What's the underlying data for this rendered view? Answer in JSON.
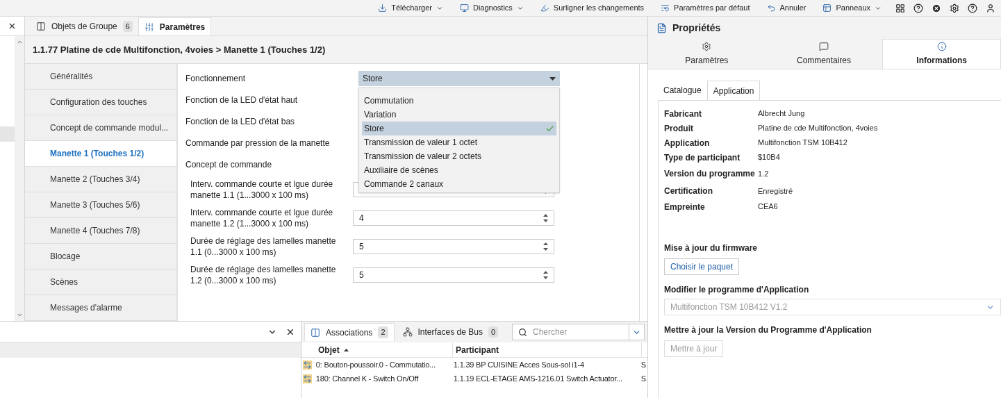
{
  "toolbar": [
    {
      "label": "Télécharger",
      "caret": true
    },
    {
      "label": "Diagnostics",
      "caret": true
    },
    {
      "label": "Surligner les changements",
      "caret": false
    },
    {
      "label": "Paramètres par défaut",
      "caret": false
    },
    {
      "label": "Annuler",
      "caret": false
    },
    {
      "label": "Panneaux",
      "caret": true
    }
  ],
  "doc_tabs": [
    {
      "label": "Objets de Groupe",
      "badge": "6",
      "selected": false
    },
    {
      "label": "Paramètres",
      "selected": true
    }
  ],
  "breadcrumb": "1.1.77 Platine de cde Multifonction, 4voies > Manette 1 (Touches 1/2)",
  "nav": [
    {
      "label": "Généralités",
      "selected": false
    },
    {
      "label": "Configuration des touches",
      "selected": false
    },
    {
      "label": "Concept de commande modul...",
      "selected": false
    },
    {
      "label": "Manette 1 (Touches 1/2)",
      "selected": true
    },
    {
      "label": "Manette 2 (Touches 3/4)",
      "selected": false
    },
    {
      "label": "Manette 3 (Touches 5/6)",
      "selected": false
    },
    {
      "label": "Manette 4 (Touches 7/8)",
      "selected": false
    },
    {
      "label": "Blocage",
      "selected": false
    },
    {
      "label": "Scènes",
      "selected": false
    },
    {
      "label": "Messages d'alarme",
      "selected": false
    }
  ],
  "form": [
    {
      "label": "Fonctionnement",
      "kind": "select",
      "value": "Store"
    },
    {
      "label": "Fonction de la LED d'état haut",
      "kind": "covered"
    },
    {
      "label": "Fonction de la LED d'état bas",
      "kind": "covered"
    },
    {
      "label": "Commande par pression de la manette",
      "kind": "covered"
    },
    {
      "label": "Concept de commande",
      "kind": "covered"
    },
    {
      "label": "Interv. commande courte et lgue durée manette 1.1 (1...3000 x 100 ms)",
      "kind": "number"
    },
    {
      "label": "Interv. commande courte et lgue durée manette 1.2 (1...3000 x 100 ms)",
      "kind": "number",
      "value": "4"
    },
    {
      "label": "Durée de réglage des lamelles manette 1.1 (0...3000 x 100 ms)",
      "kind": "number",
      "value": "5"
    },
    {
      "label": "Durée de réglage des lamelles manette 1.2 (0...3000 x 100 ms)",
      "kind": "number",
      "value": "5"
    }
  ],
  "dropdown": [
    {
      "label": "Commutation",
      "selected": false
    },
    {
      "label": "Variation",
      "selected": false
    },
    {
      "label": "Store",
      "selected": true
    },
    {
      "label": "Transmission de valeur 1 octet",
      "selected": false
    },
    {
      "label": "Transmission de valeur 2 octets",
      "selected": false
    },
    {
      "label": "Auxiliaire de scènes",
      "selected": false
    },
    {
      "label": "Commande 2 canaux",
      "selected": false
    }
  ],
  "properties": {
    "title": "Propriétés",
    "tabs": [
      {
        "label": "Paramètres",
        "selected": false
      },
      {
        "label": "Commentaires",
        "selected": false
      },
      {
        "label": "Informations",
        "selected": true
      }
    ],
    "subtabs": [
      {
        "label": "Catalogue",
        "selected": false
      },
      {
        "label": "Application",
        "selected": true
      }
    ],
    "info": [
      {
        "label": "Fabricant",
        "value": "Albrecht Jung"
      },
      {
        "label": "Produit",
        "value": "Platine de cde Multifonction, 4voies"
      },
      {
        "label": "Application",
        "value": "Multifonction TSM 10B412"
      },
      {
        "label": "Type de participant",
        "value": "$10B4"
      },
      {
        "label": "Version du programme",
        "value": "1.2"
      },
      {
        "label": "Certification",
        "value": "Enregistré"
      },
      {
        "label": "Empreinte",
        "value": "CEA6"
      }
    ],
    "firmware": {
      "heading": "Mise à jour du firmware",
      "button": "Choisir le paquet"
    },
    "modify": {
      "heading": "Modifier le programme d'Application",
      "value": "Multifonction TSM 10B412 V1.2",
      "disabled": true
    },
    "update": {
      "heading": "Mettre à jour la Version du Programme d'Application",
      "button": "Mettre à jour",
      "disabled": true
    }
  },
  "bottom_tabs": [
    {
      "label": "Associations",
      "badge": "2",
      "selected": true
    },
    {
      "label": "Interfaces de Bus",
      "badge": "0",
      "selected": false
    }
  ],
  "search": {
    "placeholder": "Chercher"
  },
  "table": {
    "columns": [
      {
        "label": "Objet",
        "sorted": true
      },
      {
        "label": "Participant",
        "sorted": false
      }
    ],
    "rows": [
      {
        "objet": "0: Bouton-poussoir.0 - Commutatio...",
        "participant": "1.1.39 BP CUISINE Acces Sous-sol i1-4",
        "column_3": "S"
      },
      {
        "objet": "180: Channel K - Switch On/Off",
        "participant": "1.1.19 ECL-ETAGE AMS-1216.01 Switch Actuator...",
        "column_3": "S"
      }
    ]
  }
}
